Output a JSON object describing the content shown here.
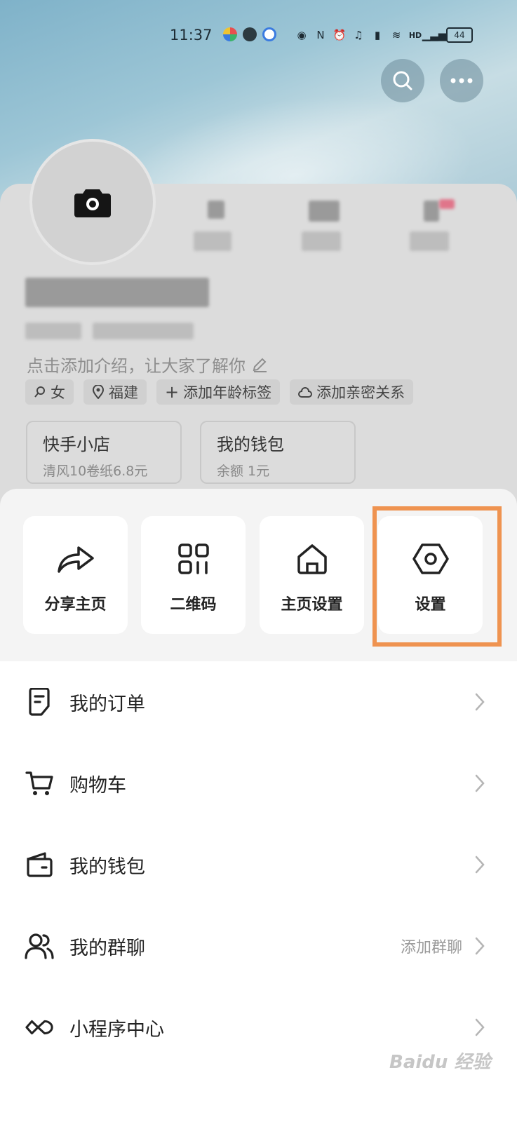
{
  "status_bar": {
    "time": "11:37",
    "battery": "44",
    "glyphs": [
      "eye-icon",
      "nfc-icon",
      "alarm-icon",
      "headphones-icon",
      "battery-small-icon",
      "wifi-icon",
      "hd-icon",
      "signal-icon"
    ]
  },
  "profile": {
    "intro": "点击添加介绍，让大家了解你",
    "tags": [
      {
        "icon": "gender-icon",
        "label": "女"
      },
      {
        "icon": "location-icon",
        "label": "福建"
      },
      {
        "icon": "plus-icon",
        "label": "添加年龄标签"
      },
      {
        "icon": "relation-icon",
        "label": "添加亲密关系"
      }
    ],
    "cards": [
      {
        "title": "快手小店",
        "sub": "清风10卷纸6.8元"
      },
      {
        "title": "我的钱包",
        "sub": "余额 1元"
      }
    ]
  },
  "actions": [
    {
      "label": "分享主页",
      "icon": "share-icon"
    },
    {
      "label": "二维码",
      "icon": "qr-code-icon"
    },
    {
      "label": "主页设置",
      "icon": "home-icon"
    },
    {
      "label": "设置",
      "icon": "gear-icon"
    }
  ],
  "menu": [
    {
      "label": "我的订单",
      "icon": "order-icon",
      "extra": ""
    },
    {
      "label": "购物车",
      "icon": "cart-icon",
      "extra": ""
    },
    {
      "label": "我的钱包",
      "icon": "wallet-icon",
      "extra": ""
    },
    {
      "label": "我的群聊",
      "icon": "group-chat-icon",
      "extra": "添加群聊"
    },
    {
      "label": "小程序中心",
      "icon": "mini-program-icon",
      "extra": ""
    }
  ],
  "watermark": "Baidu 经验",
  "colors": {
    "highlight": "#ef9350",
    "hero_top": "#7fb2c9"
  }
}
